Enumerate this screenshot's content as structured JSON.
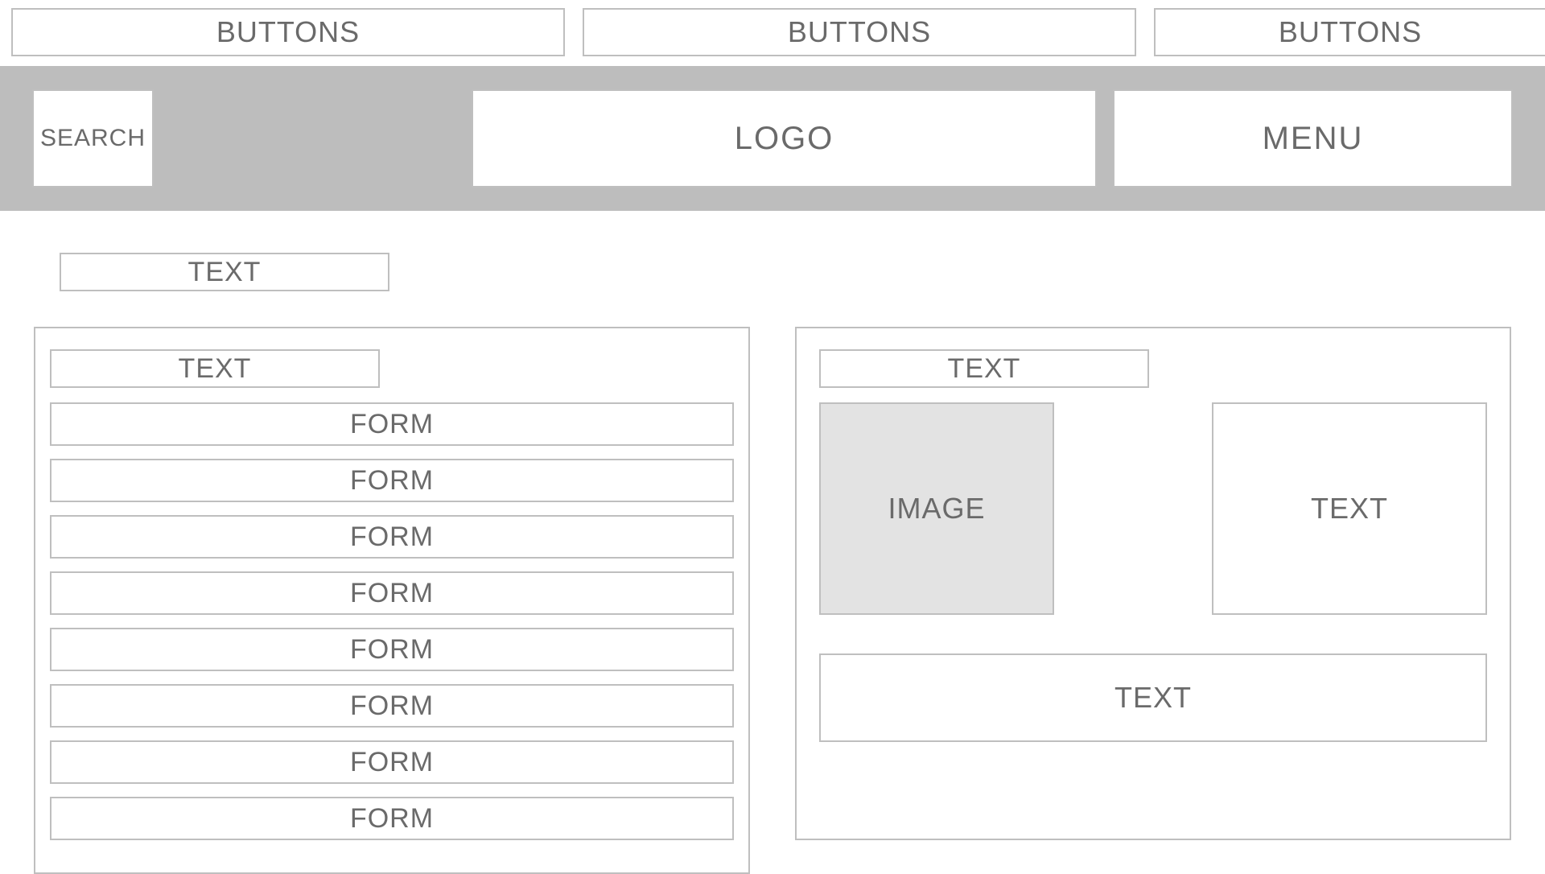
{
  "top_buttons": {
    "button1": "BUTTONS",
    "button2": "BUTTONS",
    "button3": "BUTTONS"
  },
  "header": {
    "search": "SEARCH",
    "logo": "LOGO",
    "menu": "MENU"
  },
  "page_title": "TEXT",
  "left_panel": {
    "title": "TEXT",
    "forms": [
      "FORM",
      "FORM",
      "FORM",
      "FORM",
      "FORM",
      "FORM",
      "FORM",
      "FORM"
    ]
  },
  "right_panel": {
    "title": "TEXT",
    "image": "IMAGE",
    "text_small": "TEXT",
    "text_wide": "TEXT"
  }
}
